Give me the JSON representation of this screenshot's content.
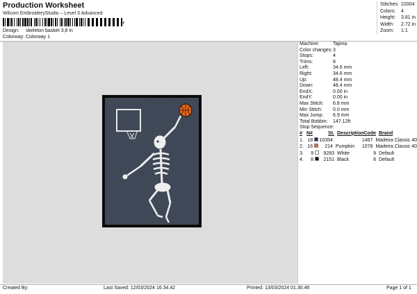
{
  "header": {
    "title": "Production Worksheet",
    "subtitle": "Wilcom EmbroideryStudio – Level 3 Advanced",
    "barcode_mark": ",",
    "design_label": "Design:",
    "design_value": "skeleton basket 3,8 in",
    "colorway_label": "Colorway:",
    "colorway_value": "Colorway 1"
  },
  "summary": [
    {
      "label": "Stitches:",
      "value": "22004"
    },
    {
      "label": "Colors:",
      "value": "4"
    },
    {
      "label": "Height:",
      "value": "3.81 in"
    },
    {
      "label": "Width:",
      "value": "2.72 in"
    },
    {
      "label": "Zoom:",
      "value": "1:1"
    }
  ],
  "machine_info": [
    {
      "label": "Machine:",
      "value": "Tajima"
    },
    {
      "label": "Color changes:",
      "value": "3"
    },
    {
      "label": "Stops:",
      "value": "4"
    },
    {
      "label": "Trims:",
      "value": "8"
    },
    {
      "label": "Left:",
      "value": "34.6 mm"
    },
    {
      "label": "Right:",
      "value": "34.6 mm"
    },
    {
      "label": "Up:",
      "value": "48.4 mm"
    },
    {
      "label": "Down:",
      "value": "48.4 mm"
    },
    {
      "label": "EndX:",
      "value": "0.00 in"
    },
    {
      "label": "EndY:",
      "value": "0.00 in"
    },
    {
      "label": "Max Stitch:",
      "value": "6.8 mm"
    },
    {
      "label": "Min Stitch:",
      "value": "0.0 mm"
    },
    {
      "label": "Max Jump:",
      "value": "6.9 mm"
    },
    {
      "label": "Total Bobbin:",
      "value": "147.12ft"
    }
  ],
  "stop_sequence": {
    "title": "Stop Sequence:",
    "columns": [
      "#",
      "N#",
      "St.",
      "Description",
      "Code",
      "Brand"
    ],
    "rows": [
      {
        "num": "1.",
        "n": "18",
        "color": "#1c2c55",
        "st": "10354",
        "desc": "",
        "code": "1467",
        "brand": "Madeira Classic 40"
      },
      {
        "num": "2.",
        "n": "16",
        "color": "#e0661e",
        "st": "214",
        "desc": "Pumpkin",
        "code": "1078",
        "brand": "Madeira Classic 40"
      },
      {
        "num": "3.",
        "n": "9",
        "color": "#ffffff",
        "st": "9283",
        "desc": "White",
        "code": "9",
        "brand": "Default"
      },
      {
        "num": "4.",
        "n": "8",
        "color": "#000000",
        "st": "2151",
        "desc": "Black",
        "code": "8",
        "brand": "Default"
      }
    ]
  },
  "footer": {
    "created_by": "Created By:",
    "last_saved": "Last Saved: 12/03/2024 16.34.42",
    "printed": "Printed: 13/03/2024 01.30.46",
    "page": "Page 1 of 1"
  }
}
